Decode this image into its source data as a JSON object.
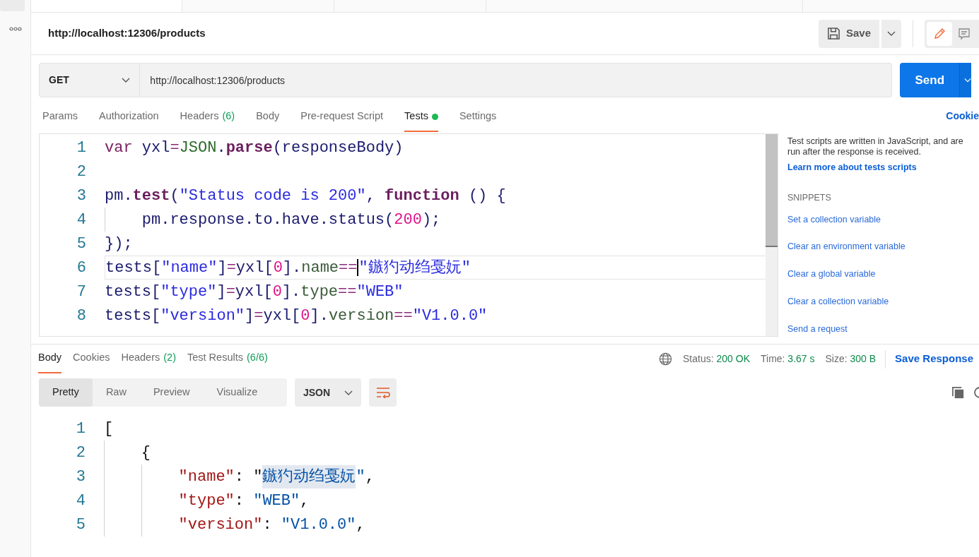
{
  "request": {
    "title": "http://localhost:12306/products",
    "save_label": "Save",
    "method": "GET",
    "url": "http://localhost:12306/products",
    "send_label": "Send",
    "mode_toggle": [
      {
        "kind": "edit",
        "selected": true
      },
      {
        "kind": "comment",
        "selected": false
      }
    ],
    "tabs": [
      {
        "label": "Params",
        "selected": false
      },
      {
        "label": "Authorization",
        "selected": false
      },
      {
        "label": "Headers",
        "count": "(6)",
        "selected": false
      },
      {
        "label": "Body",
        "selected": false
      },
      {
        "label": "Pre-request Script",
        "selected": false
      },
      {
        "label": "Tests",
        "dot": true,
        "selected": true
      },
      {
        "label": "Settings",
        "selected": false
      }
    ],
    "cookies_link": "Cookie"
  },
  "tests_editor": {
    "lines": [
      {
        "number": "1",
        "active": false,
        "tokens": [
          {
            "kind": "keyword",
            "text": "var"
          },
          {
            "kind": "ident",
            "text": " yxl"
          },
          {
            "kind": "op",
            "text": "="
          },
          {
            "kind": "global",
            "text": "JSON"
          },
          {
            "kind": "ident",
            "text": "."
          },
          {
            "kind": "method",
            "text": "parse"
          },
          {
            "kind": "ident",
            "text": "(responseBody)"
          }
        ]
      },
      {
        "number": "2",
        "active": false
      },
      {
        "number": "3",
        "active": false,
        "tokens": [
          {
            "kind": "ident",
            "text": "pm."
          },
          {
            "kind": "method",
            "text": "test"
          },
          {
            "kind": "ident",
            "text": "("
          },
          {
            "kind": "string",
            "text": "\"Status code is 200\""
          },
          {
            "kind": "ident",
            "text": ", "
          },
          {
            "kind": "method",
            "text": "function"
          },
          {
            "kind": "ident",
            "text": " () {"
          }
        ],
        "children": [
          {
            "number": "4",
            "active": false,
            "tokens": [
              {
                "kind": "ident",
                "text": "pm.response.to.have.status("
              },
              {
                "kind": "number",
                "text": "200"
              },
              {
                "kind": "ident",
                "text": ");"
              }
            ]
          }
        ]
      },
      {
        "number": "5",
        "active": false,
        "tokens": [
          {
            "kind": "ident",
            "text": "});"
          }
        ]
      },
      {
        "number": "6",
        "active": true,
        "tokens": [
          {
            "kind": "ident",
            "text": "tests["
          },
          {
            "kind": "string",
            "text": "\"name\""
          },
          {
            "kind": "ident",
            "text": "]"
          },
          {
            "kind": "op",
            "text": "="
          },
          {
            "kind": "ident",
            "text": "yxl["
          },
          {
            "kind": "number",
            "text": "0"
          },
          {
            "kind": "ident",
            "text": "]."
          },
          {
            "kind": "prop",
            "text": "name"
          },
          {
            "kind": "op",
            "text": "=="
          },
          {
            "kind": "string",
            "text": "\"鏃犳动绉戞妧\""
          }
        ]
      },
      {
        "number": "7",
        "active": false,
        "tokens": [
          {
            "kind": "ident",
            "text": "tests["
          },
          {
            "kind": "string",
            "text": "\"type\""
          },
          {
            "kind": "ident",
            "text": "]"
          },
          {
            "kind": "op",
            "text": "="
          },
          {
            "kind": "ident",
            "text": "yxl["
          },
          {
            "kind": "number",
            "text": "0"
          },
          {
            "kind": "ident",
            "text": "]."
          },
          {
            "kind": "prop",
            "text": "type"
          },
          {
            "kind": "op",
            "text": "=="
          },
          {
            "kind": "string",
            "text": "\"WEB\""
          }
        ]
      },
      {
        "number": "8",
        "active": false,
        "tokens": [
          {
            "kind": "ident",
            "text": "tests["
          },
          {
            "kind": "string",
            "text": "\"version\""
          },
          {
            "kind": "ident",
            "text": "]"
          },
          {
            "kind": "op",
            "text": "="
          },
          {
            "kind": "ident",
            "text": "yxl["
          },
          {
            "kind": "number",
            "text": "0"
          },
          {
            "kind": "ident",
            "text": "]."
          },
          {
            "kind": "prop",
            "text": "version"
          },
          {
            "kind": "op",
            "text": "=="
          },
          {
            "kind": "string",
            "text": "\"V1.0.0\""
          }
        ]
      }
    ]
  },
  "help": {
    "text": "Test scripts are written in JavaScript, and are run after the response is received.",
    "link": "Learn more about tests scripts",
    "snippets_heading": "SNIPPETS",
    "snippets": [
      "Set a collection variable",
      "Clear an environment variable",
      "Clear a global variable",
      "Clear a collection variable",
      "Send a request"
    ]
  },
  "response": {
    "tabs": [
      {
        "label": "Body",
        "selected": true
      },
      {
        "label": "Cookies",
        "selected": false
      },
      {
        "label": "Headers",
        "count": "(2)",
        "selected": false
      },
      {
        "label": "Test Results",
        "count": "(6/6)",
        "selected": false
      }
    ],
    "stats": [
      {
        "label": "Status:",
        "value": "200 OK"
      },
      {
        "label": "Time:",
        "value": "3.67 s"
      },
      {
        "label": "Size:",
        "value": "300 B"
      }
    ],
    "save_response": "Save Response",
    "views": [
      {
        "label": "Pretty",
        "selected": true
      },
      {
        "label": "Raw",
        "selected": false
      },
      {
        "label": "Preview",
        "selected": false
      },
      {
        "label": "Visualize",
        "selected": false
      }
    ],
    "format": "JSON",
    "lines": [
      {
        "number": "1",
        "tokens": [
          {
            "kind": "punct",
            "text": "["
          }
        ],
        "children": [
          {
            "number": "2",
            "tokens": [
              {
                "kind": "punct",
                "text": "{"
              }
            ],
            "children": [
              {
                "number": "3",
                "tokens": [
                  {
                    "kind": "key",
                    "text": "\"name\""
                  },
                  {
                    "kind": "punct",
                    "text": ": \""
                  },
                  {
                    "kind": "selected",
                    "text": "鏃犳动绉戞妧"
                  },
                  {
                    "kind": "value",
                    "text": "\""
                  },
                  {
                    "kind": "punct",
                    "text": ","
                  }
                ]
              },
              {
                "number": "4",
                "tokens": [
                  {
                    "kind": "key",
                    "text": "\"type\""
                  },
                  {
                    "kind": "punct",
                    "text": ": "
                  },
                  {
                    "kind": "value",
                    "text": "\"WEB\""
                  },
                  {
                    "kind": "punct",
                    "text": ","
                  }
                ]
              },
              {
                "number": "5",
                "tokens": [
                  {
                    "kind": "key",
                    "text": "\"version\""
                  },
                  {
                    "kind": "punct",
                    "text": ": "
                  },
                  {
                    "kind": "value",
                    "text": "\"V1.0.0\""
                  },
                  {
                    "kind": "punct",
                    "text": ","
                  }
                ]
              }
            ]
          }
        ]
      }
    ]
  }
}
